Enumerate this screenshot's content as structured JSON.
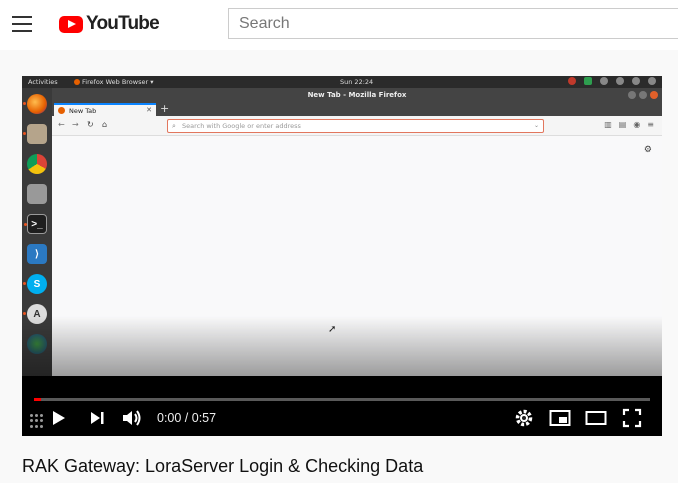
{
  "header": {
    "logo_text": "YouTube",
    "search_placeholder": "Search"
  },
  "player": {
    "ubuntu_panel": {
      "activities": "Activities",
      "app_menu": "Firefox Web Browser ▾",
      "clock": "Sun 22:24"
    },
    "firefox": {
      "window_title": "New Tab - Mozilla Firefox",
      "tab_label": "New Tab",
      "url_placeholder": "Search with Google or enter address"
    },
    "controls": {
      "time_display": "0:00 / 0:57",
      "progress_fraction": 0.012
    }
  },
  "video": {
    "title": "RAK Gateway: LoraServer Login & Checking Data"
  },
  "colors": {
    "yt_red": "#ff0000",
    "ubuntu_orange": "#e95420",
    "url_focus": "#e2775e"
  }
}
